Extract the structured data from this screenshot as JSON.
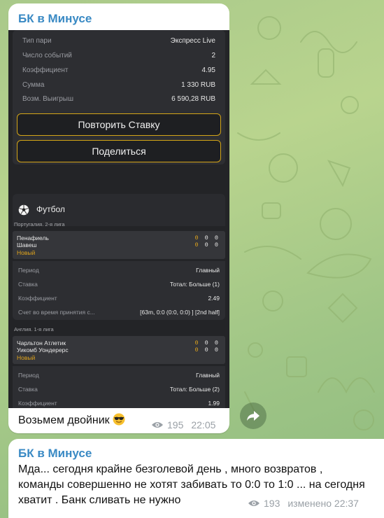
{
  "post1": {
    "channel": "БК в Минусе",
    "bet_summary": [
      {
        "key": "Тип пари",
        "value": "Экспресс Live"
      },
      {
        "key": "Число событий",
        "value": "2"
      },
      {
        "key": "Коэффициент",
        "value": "4.95"
      },
      {
        "key": "Сумма",
        "value": "1 330 RUB"
      },
      {
        "key": "Возм. Выигрыш",
        "value": "6 590,28 RUB"
      }
    ],
    "repeat_button": "Повторить Ставку",
    "share_button": "Поделиться",
    "sport": "Футбол",
    "events": [
      {
        "league": "Португалия. 2-я лига",
        "team1": "Пенафиель",
        "team2": "Шавеш",
        "status": "Новый",
        "score1": [
          "0",
          "0",
          "0"
        ],
        "score2": [
          "0",
          "0",
          "0"
        ],
        "details": [
          {
            "key": "Период",
            "value": "Главный"
          },
          {
            "key": "Ставка",
            "value": "Тотал: Больше (1)"
          },
          {
            "key": "Коэффициент",
            "value": "2.49"
          },
          {
            "key": "Счет во время принятия с...",
            "value": "[63m, 0:0 (0:0, 0:0) ] [2nd half]"
          }
        ]
      },
      {
        "league": "Англия. 1-я лига",
        "team1": "Чарльтон Атлетик",
        "team2": "Уикомб Уондерерс",
        "status": "Новый",
        "score1": [
          "0",
          "0",
          "0"
        ],
        "score2": [
          "0",
          "0",
          "0"
        ],
        "details": [
          {
            "key": "Период",
            "value": "Главный"
          },
          {
            "key": "Ставка",
            "value": "Тотал: Больше (2)"
          },
          {
            "key": "Коэффициент",
            "value": "1.99"
          }
        ]
      }
    ],
    "caption": "Возьмем двойник",
    "views": "195",
    "time": "22:05"
  },
  "post2": {
    "channel": "БК в Минусе",
    "text": "Мда... сегодня крайне безголевой день , много возвратов , команды совершенно не хотят забивать то 0:0 то 1:0 ... на сегодня хватит . Банк сливать не нужно",
    "views": "193",
    "time": "изменено 22:37"
  },
  "colors": {
    "channel_name": "#3a8ac4",
    "accent_gold": "#d4a517",
    "meta_gray": "#9aa0a6"
  }
}
